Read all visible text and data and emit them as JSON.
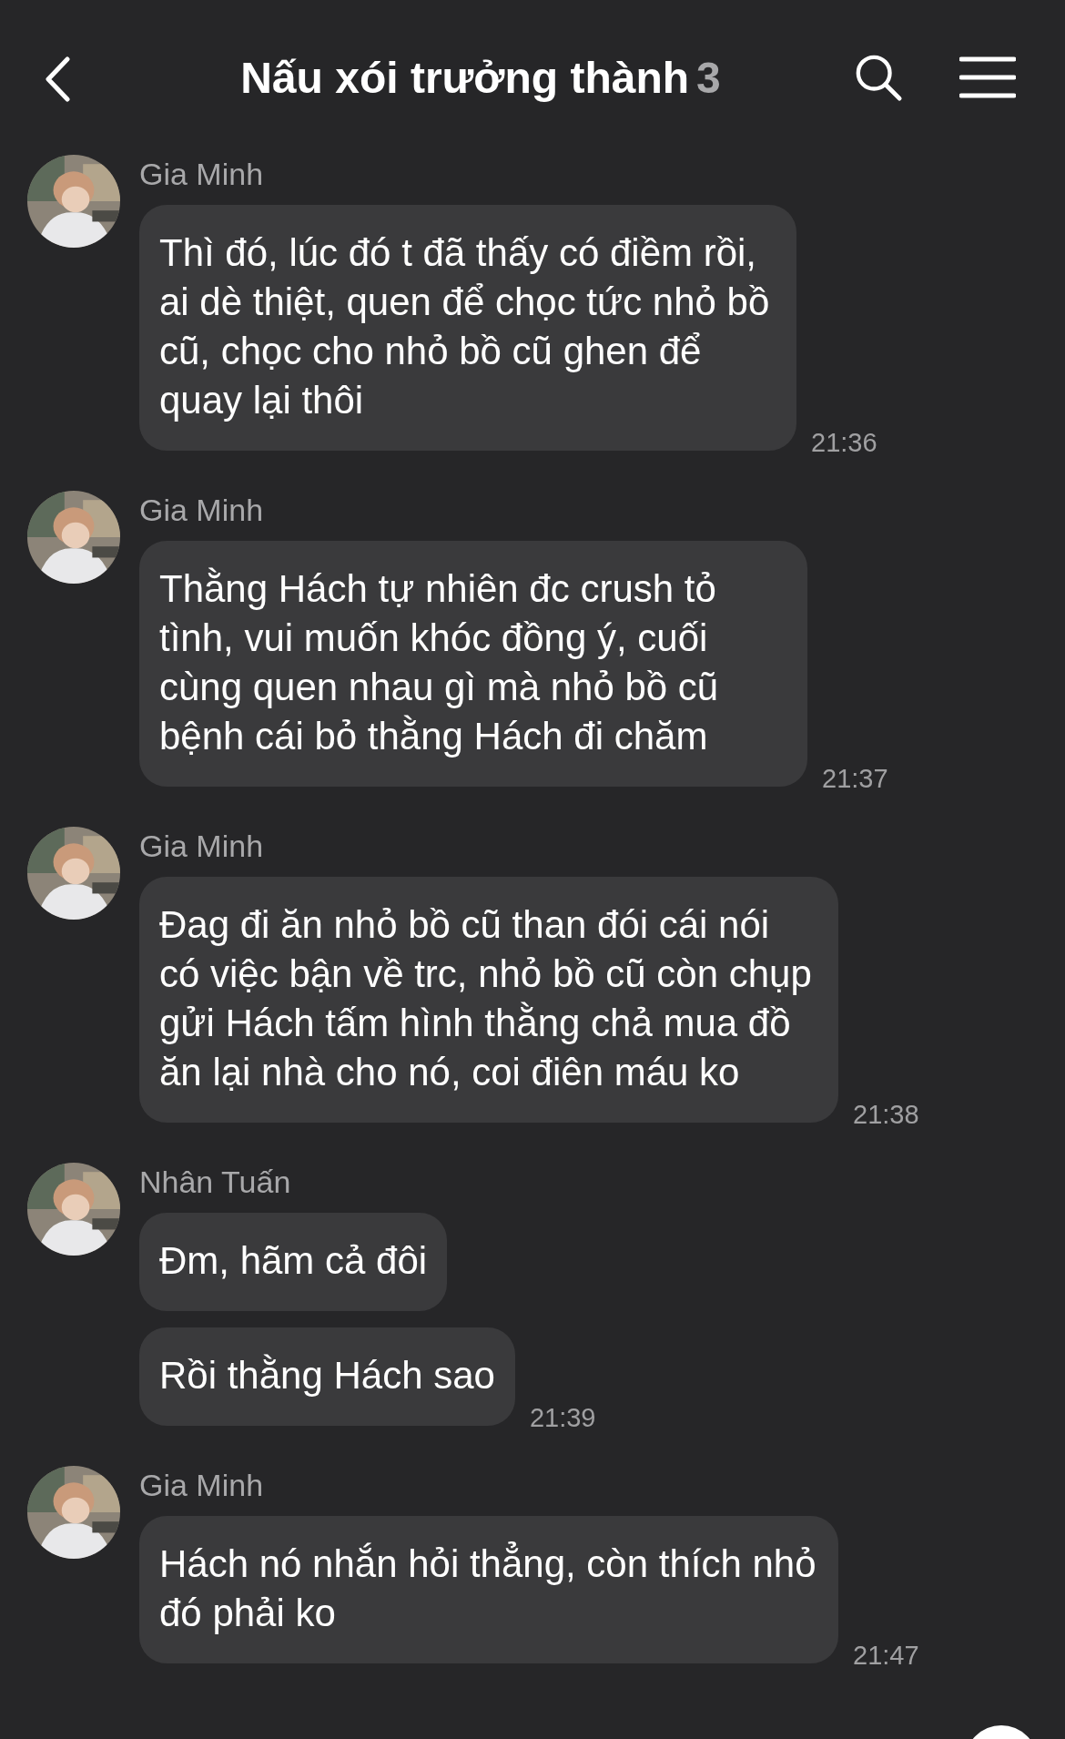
{
  "header": {
    "title": "Nấu xói trưởng thành",
    "member_count": "3"
  },
  "groups": [
    {
      "sender": "Gia Minh",
      "bubbles": [
        {
          "text": "Thì đó, lúc đó t đã thấy có điềm rồi, ai dè thiệt, quen để chọc tức nhỏ bồ cũ, chọc cho nhỏ bồ cũ ghen để quay lại thôi",
          "time": "21:36"
        }
      ]
    },
    {
      "sender": "Gia Minh",
      "bubbles": [
        {
          "text": "Thằng Hách tự nhiên đc crush tỏ tình, vui muốn khóc đồng ý, cuối cùng quen nhau gì mà nhỏ bồ cũ bệnh cái bỏ thằng Hách đi chăm",
          "time": "21:37"
        }
      ]
    },
    {
      "sender": "Gia Minh",
      "bubbles": [
        {
          "text": "Đag đi ăn nhỏ bồ cũ than đói cái nói có việc bận về trc, nhỏ bồ cũ còn chụp gửi Hách tấm hình thằng chả mua đồ ăn lại nhà cho nó, coi điên máu ko",
          "time": "21:38"
        }
      ]
    },
    {
      "sender": "Nhân Tuấn",
      "bubbles": [
        {
          "text": "Đm, hãm cả đôi"
        },
        {
          "text": "Rồi thằng Hách sao",
          "time": "21:39"
        }
      ]
    },
    {
      "sender": "Gia Minh",
      "bubbles": [
        {
          "text": "Hách nó nhắn hỏi thẳng, còn thích nhỏ đó phải ko",
          "time": "21:47"
        }
      ]
    }
  ]
}
